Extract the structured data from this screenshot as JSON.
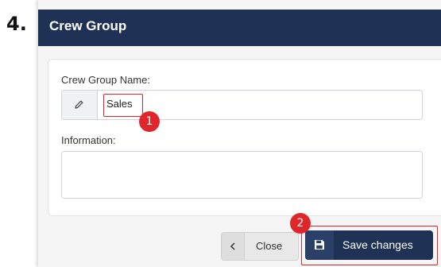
{
  "step_number": "4.",
  "dialog": {
    "title": "Crew Group"
  },
  "form": {
    "crew_group_name_label": "Crew Group Name:",
    "crew_group_name_value": "Sales",
    "information_label": "Information:",
    "information_value": ""
  },
  "callouts": {
    "name_field_badge": "1",
    "save_button_badge": "2"
  },
  "buttons": {
    "close_label": "Close",
    "save_label": "Save changes"
  },
  "colors": {
    "header_bg": "#1f3155",
    "primary_button": "#1f3155",
    "callout_red": "#e0262b"
  },
  "icons": {
    "name_addon": "pencil-icon",
    "close_button": "chevron-left-icon",
    "save_button": "floppy-disk-icon"
  }
}
